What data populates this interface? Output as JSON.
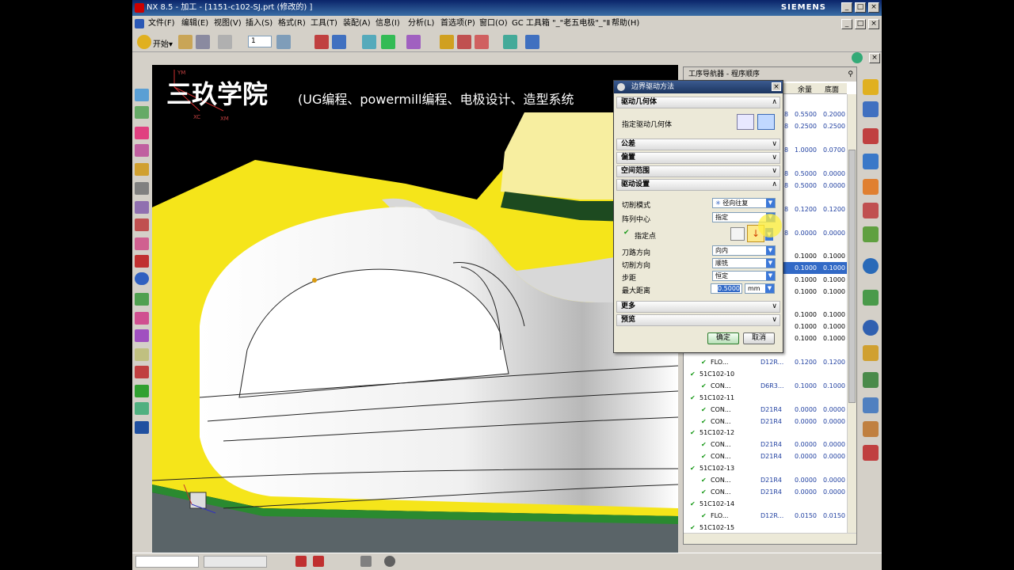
{
  "window": {
    "title": "NX 8.5 - 加工 - [1151-c102-SJ.prt (修改的) ]",
    "brand": "SIEMENS"
  },
  "menu": [
    "文件(F)",
    "编辑(E)",
    "视图(V)",
    "插入(S)",
    "格式(R)",
    "工具(T)",
    "装配(A)",
    "信息(I)",
    "分析(L)",
    "首选项(P)",
    "窗口(O)",
    "GC 工具箱",
    "\"_\"老五电极\"_\"Ⅱ",
    "帮助(H)"
  ],
  "toolbar": {
    "start_label": "开始▾",
    "layer_value": "1"
  },
  "watermark": {
    "title": "三玖学院",
    "subtitle": "(UG编程、powermill编程、电极设计、造型系统"
  },
  "axes": {
    "ym": "YM",
    "xc": "XC",
    "xm": "XM"
  },
  "navigator": {
    "title": "工序导航器 - 程序顺序",
    "columns": [
      "余量",
      "底面"
    ],
    "rows": [
      {
        "name": "",
        "tool": "8",
        "allow": "0.5500",
        "floor": "0.2000"
      },
      {
        "name": "",
        "tool": "8",
        "allow": "0.2500",
        "floor": "0.2500"
      },
      {
        "name": "",
        "tool": "8",
        "allow": "1.0000",
        "floor": "0.0700"
      },
      {
        "name": "",
        "tool": "8",
        "allow": "0.5000",
        "floor": "0.0000"
      },
      {
        "name": "",
        "tool": "8",
        "allow": "0.5000",
        "floor": "0.0000"
      },
      {
        "name": "",
        "tool": "8",
        "allow": "0.1200",
        "floor": "0.1200"
      },
      {
        "name": "",
        "tool": "8",
        "allow": "0.0000",
        "floor": "0.0000"
      },
      {
        "name": "",
        "tool": "",
        "allow": "0.1000",
        "floor": "0.1000"
      },
      {
        "name": "",
        "tool": "",
        "allow": "0.1000",
        "floor": "0.1000"
      },
      {
        "name": "",
        "tool": "",
        "allow": "0.1000",
        "floor": "0.1000"
      },
      {
        "name": "",
        "tool": "",
        "allow": "0.1000",
        "floor": "0.1000"
      },
      {
        "name": "",
        "tool": "",
        "allow": "0.1000",
        "floor": "0.1000"
      },
      {
        "name": "",
        "tool": "",
        "allow": "0.1000",
        "floor": "0.1000"
      },
      {
        "name": "",
        "tool": "",
        "allow": "0.1000",
        "floor": "0.1000"
      },
      {
        "name": "FLO...",
        "tool": "D12R...",
        "allow": "0.1200",
        "floor": "0.1200"
      },
      {
        "name": "51C102-10",
        "tool": "",
        "allow": "",
        "floor": ""
      },
      {
        "name": "CON...",
        "tool": "D6R3...",
        "allow": "0.1000",
        "floor": "0.1000"
      },
      {
        "name": "51C102-11",
        "tool": "",
        "allow": "",
        "floor": ""
      },
      {
        "name": "CON...",
        "tool": "D21R4",
        "allow": "0.0000",
        "floor": "0.0000"
      },
      {
        "name": "CON...",
        "tool": "D21R4",
        "allow": "0.0000",
        "floor": "0.0000"
      },
      {
        "name": "51C102-12",
        "tool": "",
        "allow": "",
        "floor": ""
      },
      {
        "name": "CON...",
        "tool": "D21R4",
        "allow": "0.0000",
        "floor": "0.0000"
      },
      {
        "name": "CON...",
        "tool": "D21R4",
        "allow": "0.0000",
        "floor": "0.0000"
      },
      {
        "name": "51C102-13",
        "tool": "",
        "allow": "",
        "floor": ""
      },
      {
        "name": "CON...",
        "tool": "D21R4",
        "allow": "0.0000",
        "floor": "0.0000"
      },
      {
        "name": "CON...",
        "tool": "D21R4",
        "allow": "0.0000",
        "floor": "0.0000"
      },
      {
        "name": "51C102-14",
        "tool": "",
        "allow": "",
        "floor": ""
      },
      {
        "name": "FLO...",
        "tool": "D12R...",
        "allow": "0.0150",
        "floor": "0.0150"
      },
      {
        "name": "51C102-15",
        "tool": "",
        "allow": "",
        "floor": ""
      }
    ]
  },
  "dialog": {
    "title": "边界驱动方法",
    "sections": {
      "drive_geometry": "驱动几何体",
      "tolerance": "公差",
      "offset": "偏置",
      "space_range": "空间范围",
      "drive_settings": "驱动设置",
      "more": "更多",
      "preview": "预览"
    },
    "specify_geometry": "指定驱动几何体",
    "cut_mode_label": "切削模式",
    "cut_mode_value": "径向往复",
    "array_center_label": "阵列中心",
    "array_center_value": "指定",
    "specify_point": "指定点",
    "tool_dir_label": "刀路方向",
    "tool_dir_value": "向内",
    "cut_dir_label": "切削方向",
    "cut_dir_value": "顺铣",
    "stepover_label": "步距",
    "stepover_value": "恒定",
    "max_dist_label": "最大距离",
    "max_dist_value": "0.5000",
    "max_dist_unit": "mm",
    "ok": "确定",
    "cancel": "取消"
  }
}
